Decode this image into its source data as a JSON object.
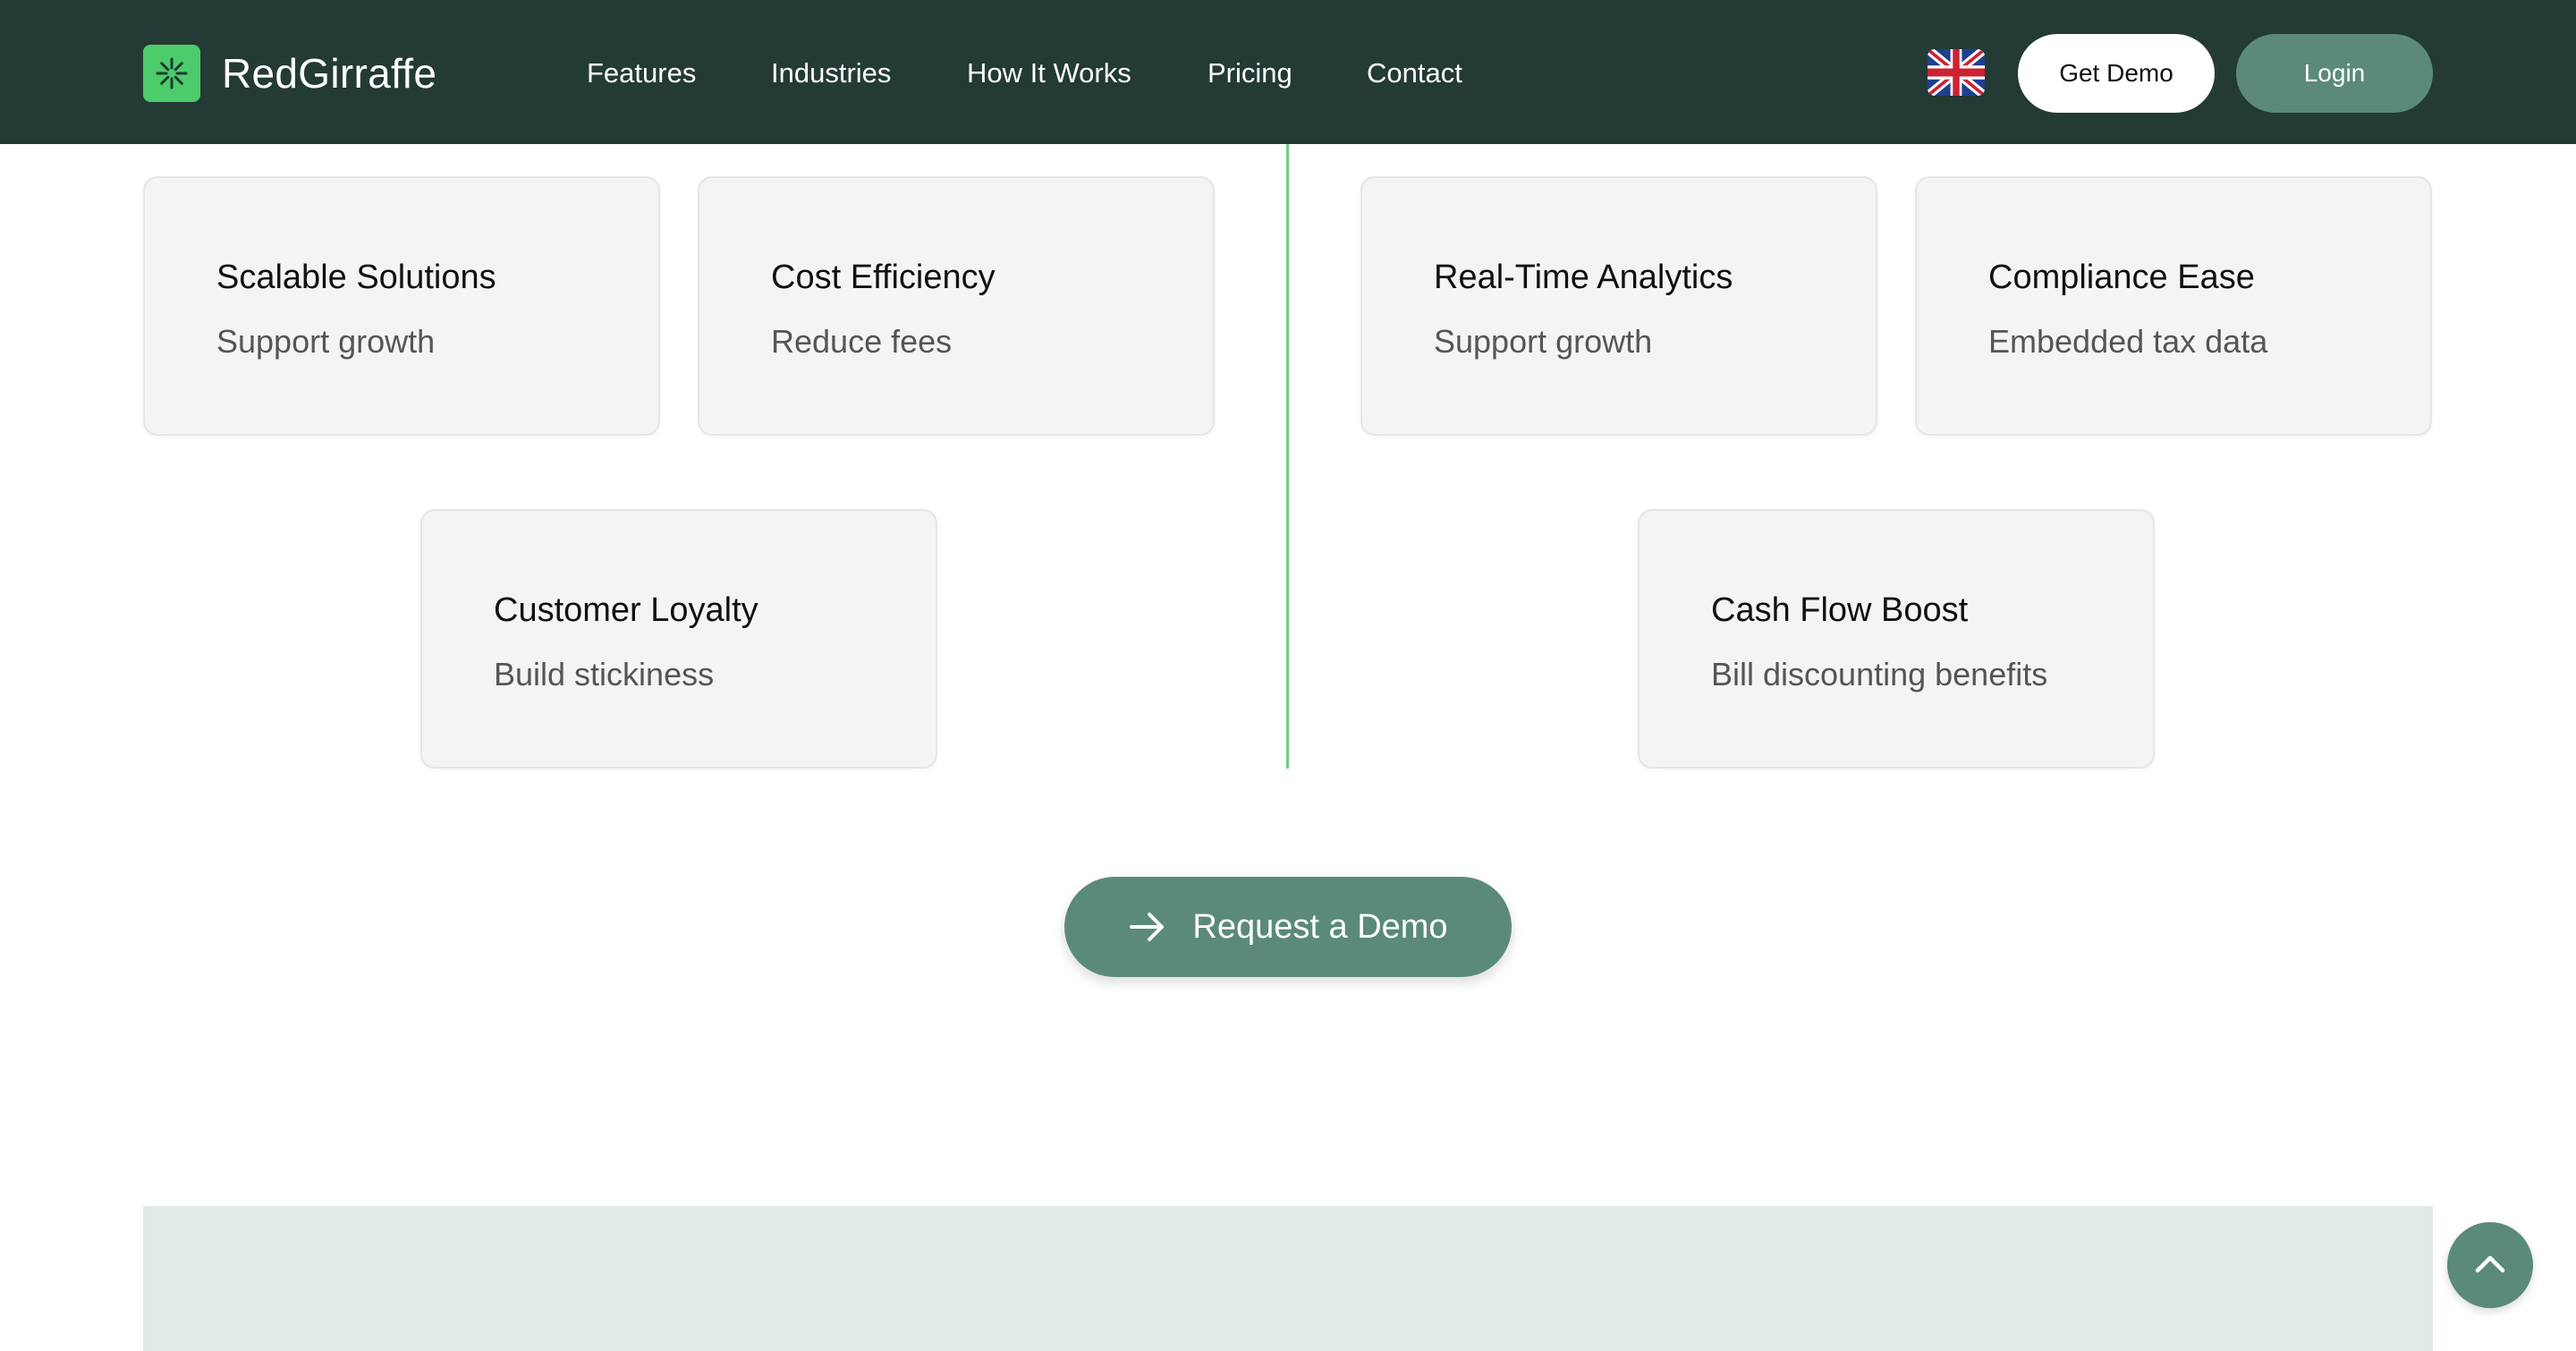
{
  "brand": {
    "name": "RedGirraffe",
    "logo_icon": "sunburst-logo-icon",
    "accent": "#4ccc6a"
  },
  "nav": {
    "items": [
      {
        "label": "Features"
      },
      {
        "label": "Industries"
      },
      {
        "label": "How It Works"
      },
      {
        "label": "Pricing"
      },
      {
        "label": "Contact"
      }
    ],
    "language_icon": "uk-flag-icon",
    "get_demo_label": "Get Demo",
    "login_label": "Login"
  },
  "cards": [
    {
      "title": "Scalable Solutions",
      "desc": "Support growth"
    },
    {
      "title": "Cost Efficiency",
      "desc": "Reduce fees"
    },
    {
      "title": "Real-Time Analytics",
      "desc": "Support growth"
    },
    {
      "title": "Compliance Ease",
      "desc": "Embedded tax data"
    },
    {
      "title": "Customer Loyalty",
      "desc": "Build stickiness"
    },
    {
      "title": "Cash Flow Boost",
      "desc": "Bill discounting benefits"
    }
  ],
  "cta": {
    "label": "Request a Demo",
    "icon": "arrow-right-icon"
  },
  "scroll_top_icon": "chevron-up-icon",
  "colors": {
    "header_bg": "#243a35",
    "primary_button": "#5b8a7a",
    "divider": "#6fce85",
    "band": "#e1eae7"
  }
}
